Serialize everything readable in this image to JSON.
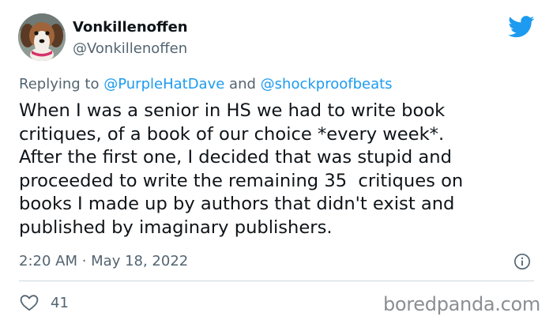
{
  "author": {
    "display_name": "Vonkillenoffen",
    "handle": "@Vonkillenoffen"
  },
  "reply": {
    "prefix": "Replying to",
    "mention1": "@PurpleHatDave",
    "conjunction": "and",
    "mention2": "@shockproofbeats"
  },
  "tweet": {
    "lines": [
      "When I was a senior in HS we had to write book",
      "critiques, of a book of our choice *every week*.",
      "After the first one, I decided that was stupid and",
      "proceeded to write the remaining 35  critiques on",
      "books I made up by authors that didn't exist and",
      "published by imaginary publishers."
    ]
  },
  "meta": {
    "timestamp": "2:20 AM · May 18, 2022"
  },
  "stats": {
    "likes": "41"
  },
  "watermark": "boredpanda.com",
  "icons": {
    "brand": "twitter-bird-icon",
    "info": "info-icon",
    "like": "heart-icon"
  },
  "colors": {
    "text": "#0f1419",
    "secondary": "#536471",
    "accent": "#1d9bf0",
    "divider": "#cfd9de"
  }
}
